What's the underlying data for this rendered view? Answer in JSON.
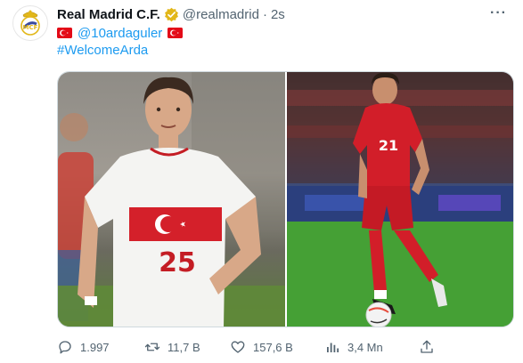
{
  "tweet": {
    "author_name": "Real Madrid C.F.",
    "handle": "@realmadrid",
    "separator": "·",
    "time": "2s",
    "more_icon": "more-icon",
    "mention": "@10ardaguler",
    "hashtag": "#WelcomeArda",
    "images": [
      {
        "name": "arda-guler-white-kit",
        "kit_number": "25"
      },
      {
        "name": "arda-guler-red-kit",
        "kit_number": "21"
      }
    ],
    "stats": {
      "replies": "1.997",
      "retweets": "11,7 B",
      "likes": "157,6 B",
      "views": "3,4 Mn"
    }
  },
  "colors": {
    "link": "#1d9bf0",
    "secondary_text": "#536471",
    "verified_gold": "#e2b719",
    "turkey_red": "#e30a17"
  }
}
